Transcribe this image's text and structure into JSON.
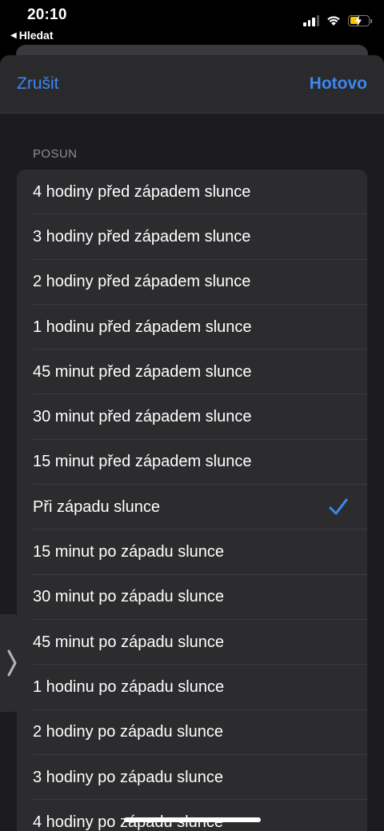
{
  "status_bar": {
    "time": "20:10",
    "back_label": "Hledat"
  },
  "nav": {
    "cancel_label": "Zrušit",
    "done_label": "Hotovo"
  },
  "section_header": "POSUN",
  "options": [
    {
      "label": "4 hodiny před západem slunce",
      "selected": false
    },
    {
      "label": "3 hodiny před západem slunce",
      "selected": false
    },
    {
      "label": "2 hodiny před západem slunce",
      "selected": false
    },
    {
      "label": "1 hodinu před západem slunce",
      "selected": false
    },
    {
      "label": "45 minut před západem slunce",
      "selected": false
    },
    {
      "label": "30 minut před západem slunce",
      "selected": false
    },
    {
      "label": "15 minut před západem slunce",
      "selected": false
    },
    {
      "label": "Při západu slunce",
      "selected": true
    },
    {
      "label": "15 minut po západu slunce",
      "selected": false
    },
    {
      "label": "30 minut po západu slunce",
      "selected": false
    },
    {
      "label": "45 minut po západu slunce",
      "selected": false
    },
    {
      "label": "1 hodinu po západu slunce",
      "selected": false
    },
    {
      "label": "2 hodiny po západu slunce",
      "selected": false
    },
    {
      "label": "3 hodiny po západu slunce",
      "selected": false
    },
    {
      "label": "4 hodiny po západu slunce",
      "selected": false
    }
  ],
  "colors": {
    "accent": "#3e86f0",
    "background": "#000000",
    "sheet": "#1c1c1e",
    "cell": "#2c2c2e",
    "battery": "#f5c400"
  },
  "icons": {
    "checkmark": "checkmark-icon",
    "side_handle": "chevron-right-icon"
  }
}
